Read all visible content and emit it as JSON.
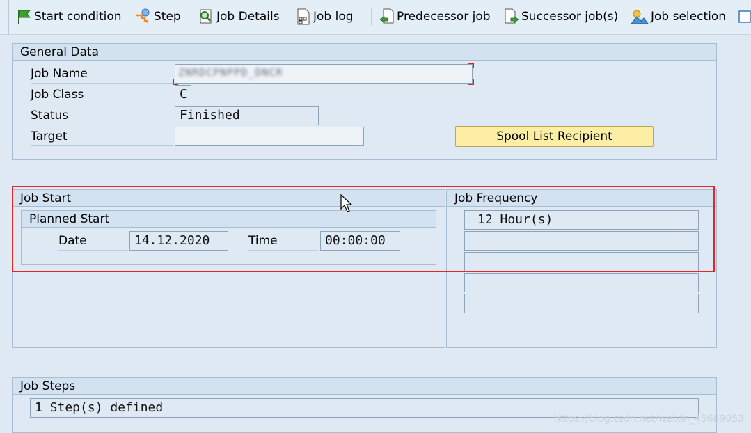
{
  "toolbar": {
    "start_condition": "Start condition",
    "step": "Step",
    "job_details": "Job Details",
    "job_log": "Job log",
    "predecessor_job": "Predecessor job",
    "successor_jobs": "Successor job(s)",
    "job_selection": "Job selection"
  },
  "general_data": {
    "title": "General Data",
    "job_name_label": "Job Name",
    "job_name_value": "ZNRDCPNPPD_DNCR",
    "job_class_label": "Job Class",
    "job_class_value": "C",
    "status_label": "Status",
    "status_value": "Finished",
    "target_label": "Target",
    "target_value": "",
    "spool_button": "Spool List Recipient"
  },
  "job_start": {
    "title": "Job Start",
    "planned_start_title": "Planned Start",
    "date_label": "Date",
    "date_value": "14.12.2020",
    "time_label": "Time",
    "time_value": "00:00:00"
  },
  "job_frequency": {
    "title": "Job Frequency",
    "rows": [
      "12 Hour(s)",
      "",
      "",
      "",
      ""
    ]
  },
  "job_steps": {
    "title": "Job Steps",
    "summary": "1 Step(s) defined"
  },
  "watermark": "https://blog.csdn.net/weixin_45689053",
  "colors": {
    "background": "#dfe9f3",
    "group_header": "#d3e2f0",
    "spool_button": "#fdeea5",
    "highlight": "#e32626"
  }
}
